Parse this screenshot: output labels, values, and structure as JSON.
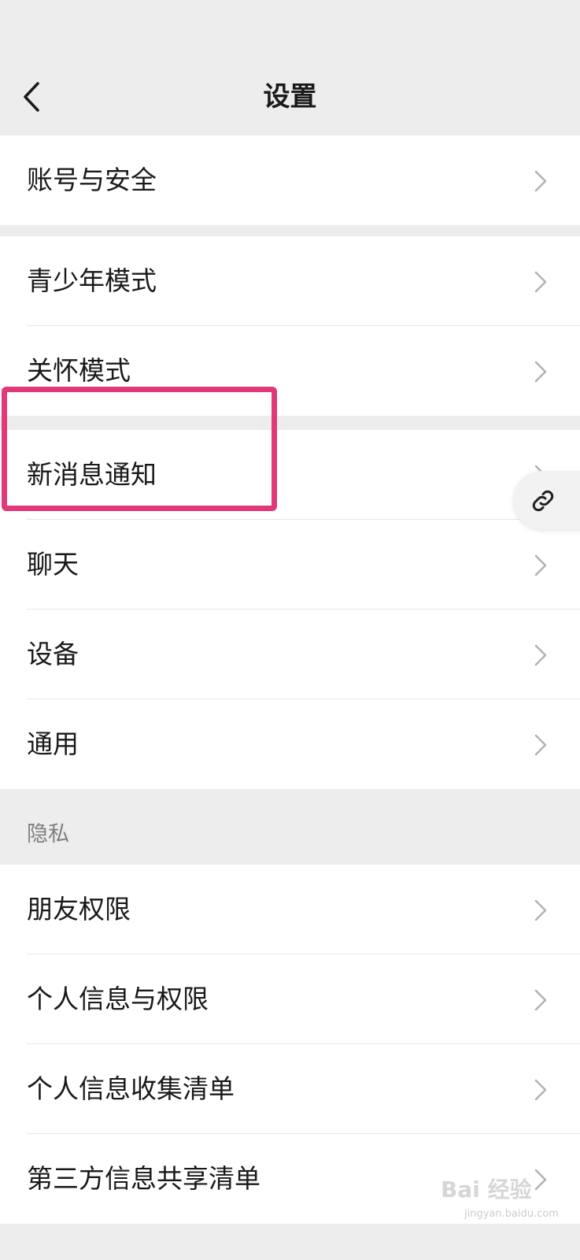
{
  "nav": {
    "title": "设置",
    "back_icon": "chevron-left-icon"
  },
  "groups": [
    {
      "items": [
        {
          "label": "账号与安全"
        }
      ]
    },
    {
      "items": [
        {
          "label": "青少年模式"
        },
        {
          "label": "关怀模式"
        }
      ]
    },
    {
      "items": [
        {
          "label": "新消息通知"
        },
        {
          "label": "聊天"
        },
        {
          "label": "设备"
        },
        {
          "label": "通用"
        }
      ]
    },
    {
      "header": "隐私",
      "items": [
        {
          "label": "朋友权限"
        },
        {
          "label": "个人信息与权限"
        },
        {
          "label": "个人信息收集清单"
        },
        {
          "label": "第三方信息共享清单"
        }
      ]
    }
  ],
  "float_button": {
    "icon": "link-icon"
  },
  "watermark": {
    "text": "Bai 经验",
    "sub": "jingyan.baidu.com"
  },
  "colors": {
    "background": "#ededed",
    "row_background": "#ffffff",
    "highlight": "#e0397a",
    "text": "#191919",
    "secondary_text": "#7f7f7f"
  }
}
